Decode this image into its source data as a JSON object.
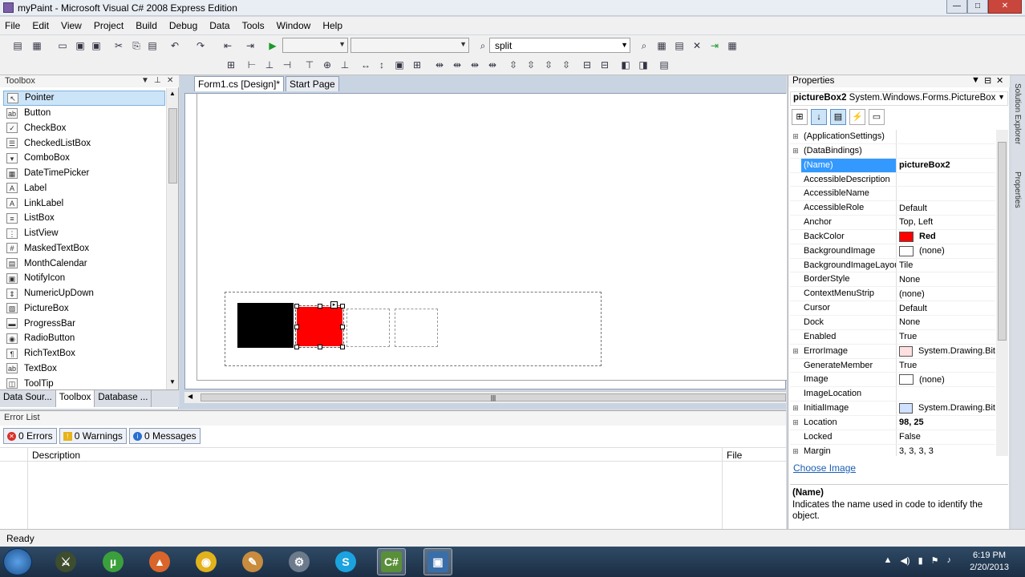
{
  "window": {
    "title": "myPaint - Microsoft Visual C# 2008 Express Edition",
    "controls": [
      "—",
      "□",
      "✕"
    ]
  },
  "menu": [
    "File",
    "Edit",
    "View",
    "Project",
    "Build",
    "Debug",
    "Data",
    "Tools",
    "Window",
    "Help"
  ],
  "toolbar": {
    "search_text": "split"
  },
  "toolbox": {
    "title": "Toolbox",
    "items": [
      {
        "label": "Pointer",
        "icon": "pointer-icon",
        "glyph": "↖"
      },
      {
        "label": "Button",
        "icon": "button-icon",
        "glyph": "ab"
      },
      {
        "label": "CheckBox",
        "icon": "checkbox-icon",
        "glyph": "✓"
      },
      {
        "label": "CheckedListBox",
        "icon": "checkedlistbox-icon",
        "glyph": "☰"
      },
      {
        "label": "ComboBox",
        "icon": "combobox-icon",
        "glyph": "▾"
      },
      {
        "label": "DateTimePicker",
        "icon": "datetimepicker-icon",
        "glyph": "▦"
      },
      {
        "label": "Label",
        "icon": "label-icon",
        "glyph": "A"
      },
      {
        "label": "LinkLabel",
        "icon": "linklabel-icon",
        "glyph": "A"
      },
      {
        "label": "ListBox",
        "icon": "listbox-icon",
        "glyph": "≡"
      },
      {
        "label": "ListView",
        "icon": "listview-icon",
        "glyph": "⋮"
      },
      {
        "label": "MaskedTextBox",
        "icon": "maskedtextbox-icon",
        "glyph": "#"
      },
      {
        "label": "MonthCalendar",
        "icon": "monthcalendar-icon",
        "glyph": "▤"
      },
      {
        "label": "NotifyIcon",
        "icon": "notifyicon-icon",
        "glyph": "▣"
      },
      {
        "label": "NumericUpDown",
        "icon": "numericupdown-icon",
        "glyph": "⇕"
      },
      {
        "label": "PictureBox",
        "icon": "picturebox-icon",
        "glyph": "▨"
      },
      {
        "label": "ProgressBar",
        "icon": "progressbar-icon",
        "glyph": "▬"
      },
      {
        "label": "RadioButton",
        "icon": "radiobutton-icon",
        "glyph": "◉"
      },
      {
        "label": "RichTextBox",
        "icon": "richtextbox-icon",
        "glyph": "¶"
      },
      {
        "label": "TextBox",
        "icon": "textbox-icon",
        "glyph": "ab"
      },
      {
        "label": "ToolTip",
        "icon": "tooltip-icon",
        "glyph": "◫"
      }
    ],
    "bottom_tabs": [
      "Data Sour...",
      "Toolbox",
      "Database ..."
    ]
  },
  "document": {
    "tabs": [
      "Form1.cs [Design]*",
      "Start Page"
    ],
    "active_tab": 0
  },
  "designer": {
    "picture_boxes": [
      {
        "color": "#000000"
      },
      {
        "color": "#ff0000"
      },
      {
        "color": "#ffffff"
      },
      {
        "color": "#ffffff"
      }
    ]
  },
  "properties": {
    "title": "Properties",
    "object_name": "pictureBox2",
    "object_type": "System.Windows.Forms.PictureBox",
    "rows": [
      {
        "name": "(ApplicationSettings)",
        "value": "",
        "expandable": true
      },
      {
        "name": "(DataBindings)",
        "value": "",
        "expandable": true
      },
      {
        "name": "(Name)",
        "value": "pictureBox2",
        "selected": true,
        "bold": true
      },
      {
        "name": "AccessibleDescription",
        "value": ""
      },
      {
        "name": "AccessibleName",
        "value": ""
      },
      {
        "name": "AccessibleRole",
        "value": "Default"
      },
      {
        "name": "Anchor",
        "value": "Top, Left"
      },
      {
        "name": "BackColor",
        "value": "Red",
        "swatch": "#ff0000",
        "bold": true
      },
      {
        "name": "BackgroundImage",
        "value": "(none)",
        "swatch": "#ffffff"
      },
      {
        "name": "BackgroundImageLayout",
        "value": "Tile"
      },
      {
        "name": "BorderStyle",
        "value": "None"
      },
      {
        "name": "ContextMenuStrip",
        "value": "(none)"
      },
      {
        "name": "Cursor",
        "value": "Default"
      },
      {
        "name": "Dock",
        "value": "None"
      },
      {
        "name": "Enabled",
        "value": "True"
      },
      {
        "name": "ErrorImage",
        "value": "System.Drawing.Bit",
        "expandable": true,
        "swatch": "#ffe0e0"
      },
      {
        "name": "GenerateMember",
        "value": "True"
      },
      {
        "name": "Image",
        "value": "(none)",
        "swatch": "#ffffff"
      },
      {
        "name": "ImageLocation",
        "value": ""
      },
      {
        "name": "InitialImage",
        "value": "System.Drawing.Bit",
        "expandable": true,
        "swatch": "#d0e0ff"
      },
      {
        "name": "Location",
        "value": "98, 25",
        "expandable": true,
        "bold": true
      },
      {
        "name": "Locked",
        "value": "False"
      },
      {
        "name": "Margin",
        "value": "3, 3, 3, 3",
        "expandable": true
      }
    ],
    "choose_image": "Choose Image",
    "desc_title": "(Name)",
    "desc_text": "Indicates the name used in code to identify the object."
  },
  "side_tabs": [
    "Solution Explorer",
    "Properties"
  ],
  "error_list": {
    "title": "Error List",
    "errors": "0 Errors",
    "warnings": "0 Warnings",
    "messages": "0 Messages",
    "col_description": "Description",
    "col_file": "File"
  },
  "status": "Ready",
  "taskbar": {
    "time": "6:19 PM",
    "date": "2/20/2013"
  }
}
